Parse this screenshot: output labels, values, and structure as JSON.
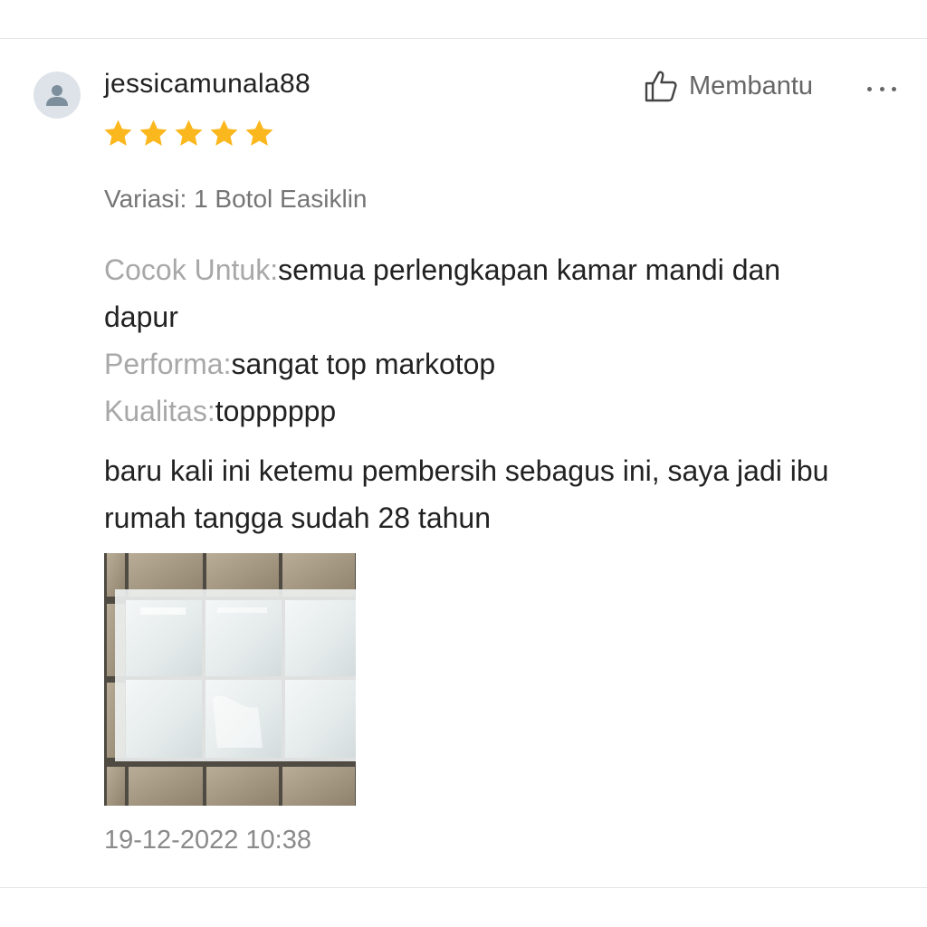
{
  "review": {
    "username": "jessicamunala88",
    "rating": 5,
    "rating_max": 5,
    "star_color": "#FBB71E",
    "helpful_label": "Membantu",
    "variation": "Variasi: 1 Botol Easiklin",
    "attributes": [
      {
        "label": "Cocok Untuk:",
        "value": "semua perlengkapan kamar mandi dan dapur"
      },
      {
        "label": "Performa:",
        "value": "sangat top markotop"
      },
      {
        "label": "Kualitas:",
        "value": "topppppp"
      }
    ],
    "text": "baru kali ini ketemu pembersih sebagus ini, saya jadi ibu rumah tangga sudah 28 tahun",
    "photo_icon": "bathroom-tiles-photo",
    "timestamp": "19-12-2022 10:38"
  }
}
